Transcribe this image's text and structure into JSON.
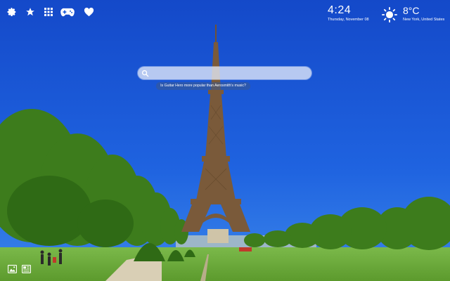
{
  "toolbar": {
    "icons": [
      "gear-icon",
      "star-icon",
      "apps-grid-icon",
      "gamepad-icon",
      "heart-icon"
    ]
  },
  "clock": {
    "time": "4:24",
    "date": "Thursday, November 08"
  },
  "weather": {
    "temperature": "8°C",
    "location": "New York, United States",
    "icon": "sun-icon"
  },
  "search": {
    "value": "",
    "placeholder": "",
    "suggestion": "Is Guitar Hero more popular than Aerosmith's music?"
  },
  "bottom_bar": {
    "icons": [
      "image-icon",
      "news-icon"
    ]
  },
  "colors": {
    "sky": "#1a5ad8",
    "grass": "#6aa83a",
    "tree": "#3f7f1e",
    "tower": "#7a5a3a"
  }
}
